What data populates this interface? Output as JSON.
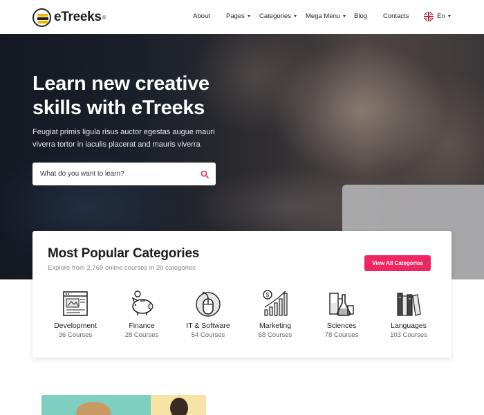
{
  "brand": {
    "name": "eTreeks",
    "registered": "®"
  },
  "nav": {
    "about": "About",
    "pages": "Pages",
    "categories": "Categories",
    "mega_menu": "Mega Menu",
    "blog": "Blog",
    "contacts": "Contacts",
    "language": "En"
  },
  "hero": {
    "title": "Learn new creative skills with eTreeks",
    "subtitle": "Feugiat primis ligula risus auctor egestas augue mauri viverra tortor in iaculis placerat and mauris viverra",
    "search_placeholder": "What do you want to learn?"
  },
  "categories": {
    "title": "Most Popular Categories",
    "subtitle": "Explore from 2,769 online courses in 20 categories",
    "view_all": "View All Categories",
    "items": [
      {
        "name": "Development",
        "count": "36 Courses",
        "icon": "browser-window-icon"
      },
      {
        "name": "Finance",
        "count": "28 Courses",
        "icon": "piggy-bank-icon"
      },
      {
        "name": "IT & Software",
        "count": "54 Courses",
        "icon": "computer-mouse-icon"
      },
      {
        "name": "Marketing",
        "count": "68 Courses",
        "icon": "growth-chart-icon"
      },
      {
        "name": "Sciences",
        "count": "78 Courses",
        "icon": "lab-flask-icon"
      },
      {
        "name": "Languages",
        "count": "103 Courses",
        "icon": "books-icon"
      }
    ]
  },
  "colors": {
    "accent": "#ee2762",
    "text_dark": "#1c1c1c",
    "text_muted": "#888888"
  }
}
